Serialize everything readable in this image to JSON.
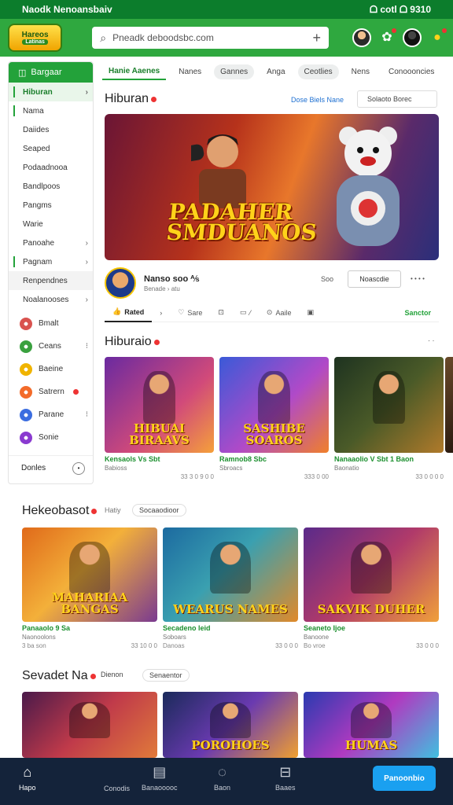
{
  "status": {
    "left": "Naodk Nenoansbaiv",
    "right": "ᗝ cotl ᗝ 9310"
  },
  "appbar": {
    "logo_line1": "Hareos",
    "logo_line2": "Latinas",
    "search_placeholder": "Pneadk deboodsbc.com",
    "plus": "+"
  },
  "sidebar": {
    "header": "Bargaar",
    "items": [
      {
        "label": "Hiburan",
        "chev": "›",
        "state": "active"
      },
      {
        "label": "Nama",
        "chev": "",
        "state": "mark"
      },
      {
        "label": "Daiides",
        "chev": "",
        "state": ""
      },
      {
        "label": "Seaped",
        "chev": "",
        "state": ""
      },
      {
        "label": "Podaadnooa",
        "chev": "",
        "state": ""
      },
      {
        "label": "Bandlpoos",
        "chev": "",
        "state": ""
      },
      {
        "label": "Pangms",
        "chev": "",
        "state": ""
      },
      {
        "label": "Warie",
        "chev": "",
        "state": ""
      },
      {
        "label": "Panoahe",
        "chev": "›",
        "state": ""
      },
      {
        "label": "Pagnam",
        "chev": "›",
        "state": "mark"
      },
      {
        "label": "Renpendnes",
        "chev": "",
        "state": "sel"
      },
      {
        "label": "Noalanooses",
        "chev": "›",
        "state": ""
      }
    ],
    "games": [
      {
        "label": "Bmalt",
        "color": "#d9534f",
        "extra": ""
      },
      {
        "label": "Ceans",
        "color": "#3aa13f",
        "extra": "⁝"
      },
      {
        "label": "Baeine",
        "color": "#f0b400",
        "extra": ""
      },
      {
        "label": "Satrern",
        "color": "#f36b2a",
        "extra": "dot"
      },
      {
        "label": "Parane",
        "color": "#3b6de0",
        "extra": "⁝"
      },
      {
        "label": "Sonie",
        "color": "#8a3ad0",
        "extra": ""
      }
    ],
    "footer": "Donles"
  },
  "tabs": [
    {
      "label": "Hanie  Aaenes",
      "kind": "active"
    },
    {
      "label": "Nanes",
      "kind": ""
    },
    {
      "label": "Gannes",
      "kind": "pill"
    },
    {
      "label": "Anga",
      "kind": ""
    },
    {
      "label": "Ceotlies",
      "kind": "pill"
    },
    {
      "label": "Nens",
      "kind": ""
    },
    {
      "label": "Conoooncies",
      "kind": ""
    }
  ],
  "featured": {
    "title": "Hiburan",
    "links": "Dose Biels  Nane",
    "sort": "Solaoto Borec",
    "hero_text_1": "PADAHER",
    "hero_text_2": "SMDUANOS",
    "channel_name": "Nanso soo ⅍",
    "channel_sub": "Benade  ›  atu",
    "count": "Soo",
    "subscribe": "Noascdie",
    "more": "• • • •"
  },
  "actions": [
    {
      "icon": "👍",
      "label": "Rated",
      "on": true
    },
    {
      "icon": "›",
      "label": "",
      "on": false
    },
    {
      "icon": "♡",
      "label": "Sare",
      "on": false
    },
    {
      "icon": "⊡",
      "label": "",
      "on": false
    },
    {
      "icon": "▭",
      "label": "⁄",
      "on": false
    },
    {
      "icon": "⊙",
      "label": "Aaile",
      "on": false
    },
    {
      "icon": "▣",
      "label": "",
      "on": false
    }
  ],
  "actions_right": "Sanctor",
  "section1": {
    "title": "Hiburaio",
    "menu": "·  ·",
    "cards": [
      {
        "thumb_text": "HIBUAI BIRAAVS",
        "title": "Kensaols Vs Sbt",
        "sub": "Babioss",
        "meta_left": "",
        "meta_right": "33 3 0 9 0 0",
        "bg": "linear-gradient(135deg,#6a2aa0,#d14a7a 60%,#f5a03a)"
      },
      {
        "thumb_text": "SASHIBE SOAROS",
        "title": "Ramnob8 Sbc",
        "sub": "Sbroacs",
        "meta_left": "",
        "meta_right": "333 0 00",
        "bg": "linear-gradient(135deg,#3a5ad8,#b04ac8 55%,#f0802a)"
      },
      {
        "thumb_text": "",
        "title": "Nanaaolio V Sbt 1 Baon",
        "sub": "Baonatio",
        "meta_left": "",
        "meta_right": "33 0 0 0 0",
        "bg": "linear-gradient(135deg,#1e3320,#4a5a28 50%,#b07a2a)"
      }
    ]
  },
  "section2": {
    "title": "Hekeobasot",
    "chip1": "Hatiy",
    "chip2": "Socaaodioor",
    "cards": [
      {
        "thumb_text": "MAHARIAA BANGAS",
        "title": "Panaaolo 9 Sa",
        "sub": "Naonoolons",
        "meta_left": "3 ba son",
        "meta_right": "33 10 0 0",
        "bg": "linear-gradient(135deg,#e06a1a,#f3b03a 45%,#7a3a90)"
      },
      {
        "thumb_text": "WEARUS NAMES",
        "title": "Secadeno leid",
        "sub": "Soboars",
        "meta_left": "Danoas",
        "meta_right": "33 0 0 0",
        "bg": "linear-gradient(135deg,#1c6aa0,#3aa0b0 45%,#e08a2a)"
      },
      {
        "thumb_text": "SAKVIK DUHER",
        "title": "Seaneto Ijoe",
        "sub": "Banoone",
        "meta_left": "Bo vroe",
        "meta_right": "33 0 0 0",
        "bg": "linear-gradient(135deg,#5a2a8a,#b03a6a 50%,#f0a03a)"
      }
    ]
  },
  "section3": {
    "title": "Sevadet Na",
    "chip1": "Dienon",
    "chip2": "Senaentor",
    "cards": [
      {
        "thumb_text": "",
        "bg": "linear-gradient(135deg,#4a1a4a,#c03a4a 50%,#e07a3a)"
      },
      {
        "thumb_text": "POROHOES",
        "bg": "linear-gradient(135deg,#1a2a5a,#6a3ab0 50%,#f0a030)"
      },
      {
        "thumb_text": "HUMAS",
        "bg": "linear-gradient(135deg,#2a3ab0,#b03ac0 50%,#40c0e0)"
      }
    ]
  },
  "bottomnav": [
    {
      "icon": "⌂",
      "label": "Hapo",
      "active": true
    },
    {
      "icon": "",
      "label": "Conodis",
      "active": false
    },
    {
      "icon": "▤",
      "label": "Banaooooc",
      "active": false
    },
    {
      "icon": "◌",
      "label": "Baon",
      "active": false
    },
    {
      "icon": "⊟",
      "label": "Baaes",
      "active": false
    }
  ],
  "bottom_cta": "Panoonbio",
  "colors": {
    "primary": "#2fa83f",
    "status": "#0c7d2c",
    "accent_link": "#1d6fd1",
    "nav_bg": "#14233a",
    "cta": "#1aa0f0"
  }
}
